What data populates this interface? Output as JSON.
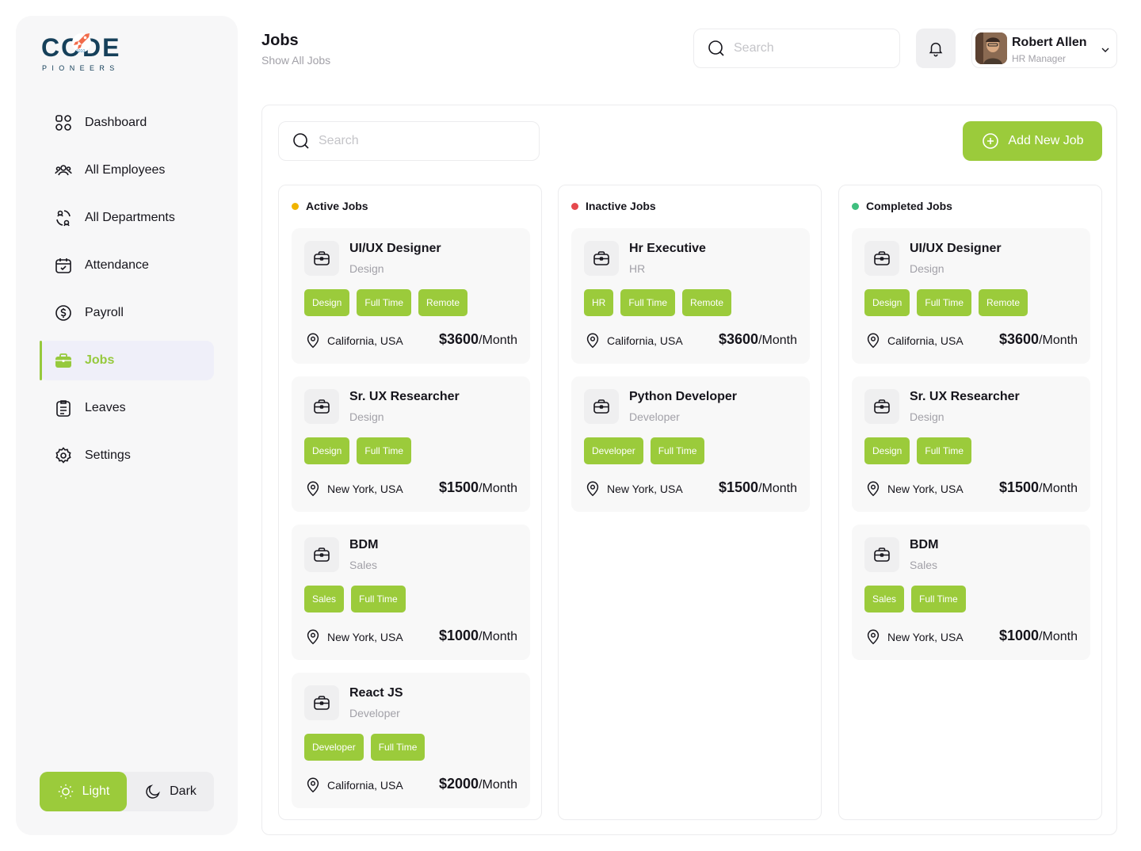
{
  "brand": {
    "logo_main": "CODE",
    "logo_sub": "PIONEERS",
    "rocket_badge": "1010"
  },
  "sidebar": {
    "items": [
      {
        "label": "Dashboard",
        "icon": "grid-icon"
      },
      {
        "label": "All Employees",
        "icon": "users-icon"
      },
      {
        "label": "All Departments",
        "icon": "departments-icon"
      },
      {
        "label": "Attendance",
        "icon": "calendar-check-icon"
      },
      {
        "label": "Payroll",
        "icon": "dollar-icon"
      },
      {
        "label": "Jobs",
        "icon": "briefcase-icon",
        "active": true
      },
      {
        "label": "Leaves",
        "icon": "clipboard-icon"
      },
      {
        "label": "Settings",
        "icon": "gear-icon"
      }
    ]
  },
  "theme": {
    "light": "Light",
    "dark": "Dark",
    "selected": "Light"
  },
  "header": {
    "title": "Jobs",
    "subtitle": "Show All Jobs",
    "search_placeholder": "Search"
  },
  "user": {
    "name": "Robert Allen",
    "role": "HR Manager"
  },
  "panel": {
    "search_placeholder": "Search",
    "add_button": "Add New Job"
  },
  "colors": {
    "accent": "#9bcb3b",
    "active": "#f0b400",
    "inactive": "#e5484d",
    "completed": "#3fbf7f"
  },
  "columns": [
    {
      "title": "Active Jobs",
      "jobs": [
        {
          "title": "UI/UX Designer",
          "dept": "Design",
          "tags": [
            "Design",
            "Full Time",
            "Remote"
          ],
          "location": "California, USA",
          "salary": "$3600",
          "period": "/Month"
        },
        {
          "title": "Sr. UX Researcher",
          "dept": "Design",
          "tags": [
            "Design",
            "Full Time"
          ],
          "location": "New York, USA",
          "salary": "$1500",
          "period": "/Month"
        },
        {
          "title": "BDM",
          "dept": "Sales",
          "tags": [
            "Sales",
            "Full Time"
          ],
          "location": "New York, USA",
          "salary": "$1000",
          "period": "/Month"
        },
        {
          "title": "React JS",
          "dept": "Developer",
          "tags": [
            "Developer",
            "Full Time"
          ],
          "location": "California, USA",
          "salary": "$2000",
          "period": "/Month"
        }
      ]
    },
    {
      "title": "Inactive Jobs",
      "jobs": [
        {
          "title": "Hr Executive",
          "dept": "HR",
          "tags": [
            "HR",
            "Full Time",
            "Remote"
          ],
          "location": "California, USA",
          "salary": "$3600",
          "period": "/Month"
        },
        {
          "title": "Python Developer",
          "dept": "Developer",
          "tags": [
            "Developer",
            "Full Time"
          ],
          "location": "New York, USA",
          "salary": "$1500",
          "period": "/Month"
        }
      ]
    },
    {
      "title": "Completed Jobs",
      "jobs": [
        {
          "title": "UI/UX Designer",
          "dept": "Design",
          "tags": [
            "Design",
            "Full Time",
            "Remote"
          ],
          "location": "California, USA",
          "salary": "$3600",
          "period": "/Month"
        },
        {
          "title": "Sr. UX Researcher",
          "dept": "Design",
          "tags": [
            "Design",
            "Full Time"
          ],
          "location": "New York, USA",
          "salary": "$1500",
          "period": "/Month"
        },
        {
          "title": "BDM",
          "dept": "Sales",
          "tags": [
            "Sales",
            "Full Time"
          ],
          "location": "New York, USA",
          "salary": "$1000",
          "period": "/Month"
        }
      ]
    }
  ]
}
